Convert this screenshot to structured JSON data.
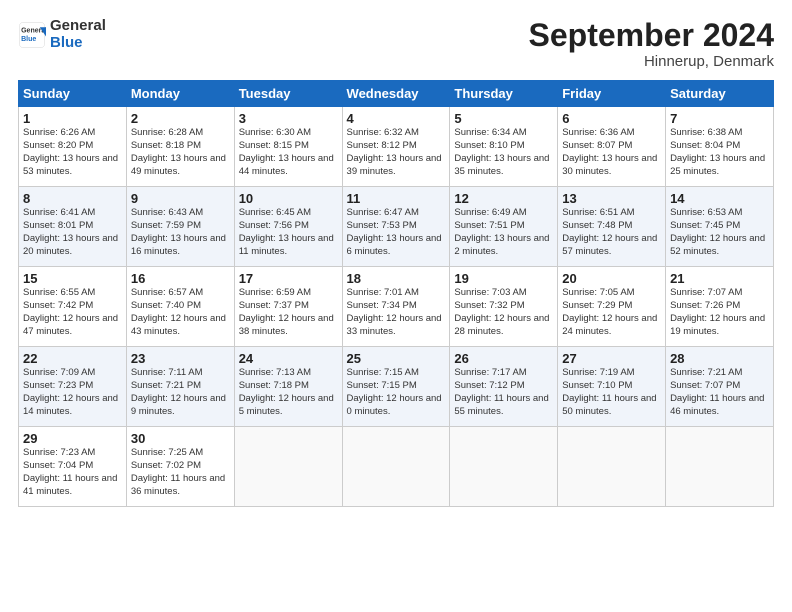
{
  "logo": {
    "general": "General",
    "blue": "Blue"
  },
  "title": "September 2024",
  "subtitle": "Hinnerup, Denmark",
  "weekdays": [
    "Sunday",
    "Monday",
    "Tuesday",
    "Wednesday",
    "Thursday",
    "Friday",
    "Saturday"
  ],
  "weeks": [
    [
      {
        "day": "1",
        "sunrise": "Sunrise: 6:26 AM",
        "sunset": "Sunset: 8:20 PM",
        "daylight": "Daylight: 13 hours and 53 minutes."
      },
      {
        "day": "2",
        "sunrise": "Sunrise: 6:28 AM",
        "sunset": "Sunset: 8:18 PM",
        "daylight": "Daylight: 13 hours and 49 minutes."
      },
      {
        "day": "3",
        "sunrise": "Sunrise: 6:30 AM",
        "sunset": "Sunset: 8:15 PM",
        "daylight": "Daylight: 13 hours and 44 minutes."
      },
      {
        "day": "4",
        "sunrise": "Sunrise: 6:32 AM",
        "sunset": "Sunset: 8:12 PM",
        "daylight": "Daylight: 13 hours and 39 minutes."
      },
      {
        "day": "5",
        "sunrise": "Sunrise: 6:34 AM",
        "sunset": "Sunset: 8:10 PM",
        "daylight": "Daylight: 13 hours and 35 minutes."
      },
      {
        "day": "6",
        "sunrise": "Sunrise: 6:36 AM",
        "sunset": "Sunset: 8:07 PM",
        "daylight": "Daylight: 13 hours and 30 minutes."
      },
      {
        "day": "7",
        "sunrise": "Sunrise: 6:38 AM",
        "sunset": "Sunset: 8:04 PM",
        "daylight": "Daylight: 13 hours and 25 minutes."
      }
    ],
    [
      {
        "day": "8",
        "sunrise": "Sunrise: 6:41 AM",
        "sunset": "Sunset: 8:01 PM",
        "daylight": "Daylight: 13 hours and 20 minutes."
      },
      {
        "day": "9",
        "sunrise": "Sunrise: 6:43 AM",
        "sunset": "Sunset: 7:59 PM",
        "daylight": "Daylight: 13 hours and 16 minutes."
      },
      {
        "day": "10",
        "sunrise": "Sunrise: 6:45 AM",
        "sunset": "Sunset: 7:56 PM",
        "daylight": "Daylight: 13 hours and 11 minutes."
      },
      {
        "day": "11",
        "sunrise": "Sunrise: 6:47 AM",
        "sunset": "Sunset: 7:53 PM",
        "daylight": "Daylight: 13 hours and 6 minutes."
      },
      {
        "day": "12",
        "sunrise": "Sunrise: 6:49 AM",
        "sunset": "Sunset: 7:51 PM",
        "daylight": "Daylight: 13 hours and 2 minutes."
      },
      {
        "day": "13",
        "sunrise": "Sunrise: 6:51 AM",
        "sunset": "Sunset: 7:48 PM",
        "daylight": "Daylight: 12 hours and 57 minutes."
      },
      {
        "day": "14",
        "sunrise": "Sunrise: 6:53 AM",
        "sunset": "Sunset: 7:45 PM",
        "daylight": "Daylight: 12 hours and 52 minutes."
      }
    ],
    [
      {
        "day": "15",
        "sunrise": "Sunrise: 6:55 AM",
        "sunset": "Sunset: 7:42 PM",
        "daylight": "Daylight: 12 hours and 47 minutes."
      },
      {
        "day": "16",
        "sunrise": "Sunrise: 6:57 AM",
        "sunset": "Sunset: 7:40 PM",
        "daylight": "Daylight: 12 hours and 43 minutes."
      },
      {
        "day": "17",
        "sunrise": "Sunrise: 6:59 AM",
        "sunset": "Sunset: 7:37 PM",
        "daylight": "Daylight: 12 hours and 38 minutes."
      },
      {
        "day": "18",
        "sunrise": "Sunrise: 7:01 AM",
        "sunset": "Sunset: 7:34 PM",
        "daylight": "Daylight: 12 hours and 33 minutes."
      },
      {
        "day": "19",
        "sunrise": "Sunrise: 7:03 AM",
        "sunset": "Sunset: 7:32 PM",
        "daylight": "Daylight: 12 hours and 28 minutes."
      },
      {
        "day": "20",
        "sunrise": "Sunrise: 7:05 AM",
        "sunset": "Sunset: 7:29 PM",
        "daylight": "Daylight: 12 hours and 24 minutes."
      },
      {
        "day": "21",
        "sunrise": "Sunrise: 7:07 AM",
        "sunset": "Sunset: 7:26 PM",
        "daylight": "Daylight: 12 hours and 19 minutes."
      }
    ],
    [
      {
        "day": "22",
        "sunrise": "Sunrise: 7:09 AM",
        "sunset": "Sunset: 7:23 PM",
        "daylight": "Daylight: 12 hours and 14 minutes."
      },
      {
        "day": "23",
        "sunrise": "Sunrise: 7:11 AM",
        "sunset": "Sunset: 7:21 PM",
        "daylight": "Daylight: 12 hours and 9 minutes."
      },
      {
        "day": "24",
        "sunrise": "Sunrise: 7:13 AM",
        "sunset": "Sunset: 7:18 PM",
        "daylight": "Daylight: 12 hours and 5 minutes."
      },
      {
        "day": "25",
        "sunrise": "Sunrise: 7:15 AM",
        "sunset": "Sunset: 7:15 PM",
        "daylight": "Daylight: 12 hours and 0 minutes."
      },
      {
        "day": "26",
        "sunrise": "Sunrise: 7:17 AM",
        "sunset": "Sunset: 7:12 PM",
        "daylight": "Daylight: 11 hours and 55 minutes."
      },
      {
        "day": "27",
        "sunrise": "Sunrise: 7:19 AM",
        "sunset": "Sunset: 7:10 PM",
        "daylight": "Daylight: 11 hours and 50 minutes."
      },
      {
        "day": "28",
        "sunrise": "Sunrise: 7:21 AM",
        "sunset": "Sunset: 7:07 PM",
        "daylight": "Daylight: 11 hours and 46 minutes."
      }
    ],
    [
      {
        "day": "29",
        "sunrise": "Sunrise: 7:23 AM",
        "sunset": "Sunset: 7:04 PM",
        "daylight": "Daylight: 11 hours and 41 minutes."
      },
      {
        "day": "30",
        "sunrise": "Sunrise: 7:25 AM",
        "sunset": "Sunset: 7:02 PM",
        "daylight": "Daylight: 11 hours and 36 minutes."
      },
      null,
      null,
      null,
      null,
      null
    ]
  ]
}
